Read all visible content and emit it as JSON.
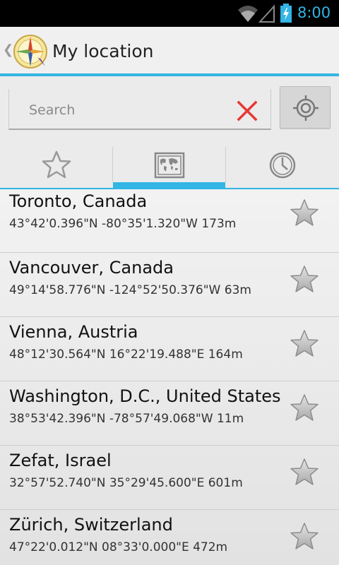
{
  "status_bar": {
    "time": "8:00",
    "wifi_icon": "wifi-icon",
    "signal_icon": "signal-icon",
    "battery_icon": "battery-charging-icon",
    "accent": "#33b5e5"
  },
  "action_bar": {
    "title": "My location",
    "app_icon": "compass-app-icon",
    "up_icon": "up-caret-icon"
  },
  "search": {
    "placeholder": "Search",
    "value": "",
    "clear_icon": "clear-x-icon",
    "clear_color": "#e53935",
    "locate_icon": "my-location-icon"
  },
  "tabs": [
    {
      "name": "favorites",
      "icon": "star-outline-icon",
      "selected": false
    },
    {
      "name": "map",
      "icon": "world-map-icon",
      "selected": true
    },
    {
      "name": "history",
      "icon": "clock-icon",
      "selected": false
    }
  ],
  "locations": [
    {
      "city": "Toronto, Canada",
      "coords": "43°42'0.396\"N -80°35'1.320\"W 173m",
      "favorite": false
    },
    {
      "city": "Vancouver, Canada",
      "coords": "49°14'58.776\"N -124°52'50.376\"W 63m",
      "favorite": false
    },
    {
      "city": "Vienna, Austria",
      "coords": "48°12'30.564\"N 16°22'19.488\"E 164m",
      "favorite": false
    },
    {
      "city": "Washington, D.C., United States",
      "coords": "38°53'42.396\"N -78°57'49.068\"W 11m",
      "favorite": false
    },
    {
      "city": "Zefat, Israel",
      "coords": "32°57'52.740\"N 35°29'45.600\"E 601m",
      "favorite": false
    },
    {
      "city": "Zürich, Switzerland",
      "coords": "47°22'0.012\"N 08°33'0.000\"E 472m",
      "favorite": false
    }
  ]
}
